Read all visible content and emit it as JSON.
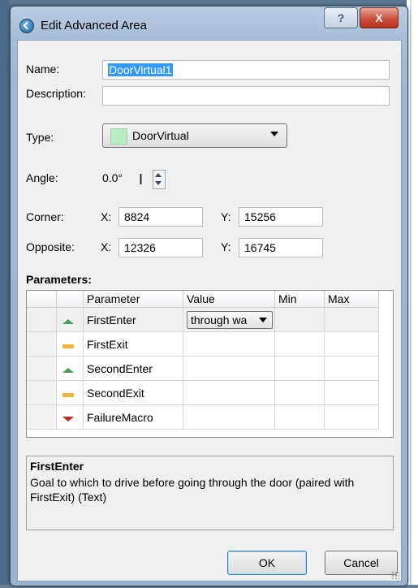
{
  "window": {
    "title": "Edit Advanced Area",
    "help_glyph": "?",
    "close_glyph": "X"
  },
  "form": {
    "name_label": "Name:",
    "name_value": "DoorVirtual1",
    "description_label": "Description:",
    "description_value": "",
    "type_label": "Type:",
    "type_value": "DoorVirtual",
    "type_color": "#b9ecc6",
    "angle_label": "Angle:",
    "angle_value": "0.0°",
    "corner_label": "Corner:",
    "corner_x_label": "X:",
    "corner_x": "8824",
    "corner_y_label": "Y:",
    "corner_y": "15256",
    "opposite_label": "Opposite:",
    "opposite_x_label": "X:",
    "opposite_x": "12326",
    "opposite_y_label": "Y:",
    "opposite_y": "16745"
  },
  "parameters": {
    "title": "Parameters:",
    "headers": [
      "Parameter",
      "Value",
      "Min",
      "Max"
    ],
    "rows": [
      {
        "icon": "arrow-up-icon",
        "name": "FirstEnter",
        "value": "through wa"
      },
      {
        "icon": "dash-icon",
        "name": "FirstExit",
        "value": ""
      },
      {
        "icon": "arrow-up-icon",
        "name": "SecondEnter",
        "value": ""
      },
      {
        "icon": "dash-icon",
        "name": "SecondExit",
        "value": ""
      },
      {
        "icon": "arrow-down-icon",
        "name": "FailureMacro",
        "value": ""
      }
    ]
  },
  "description_box": {
    "title": "FirstEnter",
    "text": "Goal to which to drive before going through the door (paired with FirstExit) (Text)"
  },
  "buttons": {
    "ok": "OK",
    "cancel": "Cancel"
  }
}
